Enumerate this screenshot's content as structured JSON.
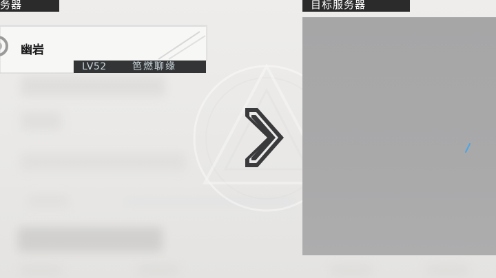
{
  "sections": {
    "current_label": "务器",
    "target_label": "目标服务器"
  },
  "character": {
    "name": "幽岩",
    "level": "LV52",
    "server": "笆燃聊缘"
  },
  "colors": {
    "header_bg": "#2b2b2b",
    "info_bar_bg": "#333436",
    "info_text": "#c9d6dc",
    "panel_bg": "#a8a8a9",
    "spinner": "#4aa6e8"
  },
  "icons": {
    "arrow": "chevron-right-icon",
    "spinner": "loading-icon",
    "avatar": "avatar-ring-icon"
  }
}
